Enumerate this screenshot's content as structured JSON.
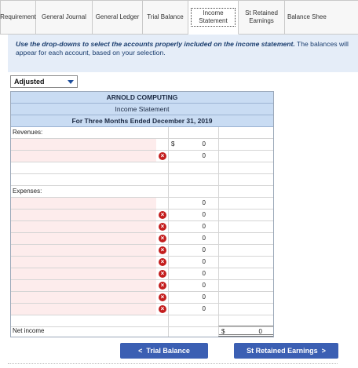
{
  "tabs": [
    {
      "label": "Requirement",
      "active": false
    },
    {
      "label": "General Journal",
      "active": false
    },
    {
      "label": "General Ledger",
      "active": false
    },
    {
      "label": "Trial Balance",
      "active": false
    },
    {
      "label": "Income Statement",
      "active": true
    },
    {
      "label": "St Retained Earnings",
      "active": false
    },
    {
      "label": "Balance Shee",
      "active": false
    }
  ],
  "instructions": {
    "emphasis": "Use the drop-downs to select the accounts properly included on the income statement.",
    "rest": " The balances will appear for each account, based on your selection."
  },
  "dropdown": {
    "value": "Adjusted"
  },
  "statement": {
    "company": "ARNOLD COMPUTING",
    "title": "Income Statement",
    "period": "For Three Months Ended December 31, 2019",
    "revenues_label": "Revenues:",
    "revenue_rows": [
      {
        "currency": "$",
        "value": "0"
      },
      {
        "value": "0"
      }
    ],
    "expenses_label": "Expenses:",
    "expense_rows": [
      {
        "value": "0"
      },
      {
        "value": "0"
      },
      {
        "value": "0"
      },
      {
        "value": "0"
      },
      {
        "value": "0"
      },
      {
        "value": "0"
      },
      {
        "value": "0"
      },
      {
        "value": "0"
      },
      {
        "value": "0"
      },
      {
        "value": "0"
      }
    ],
    "net_income_label": "Net income",
    "net_income_currency": "$",
    "net_income_value": "0"
  },
  "nav": {
    "prev_label": "Trial Balance",
    "next_label": "St Retained Earnings",
    "prev_chevron": "<",
    "next_chevron": ">"
  },
  "colors": {
    "header_bg": "#c9dcf3",
    "button_bg": "#3b5fb3",
    "error": "#c41e1e"
  }
}
